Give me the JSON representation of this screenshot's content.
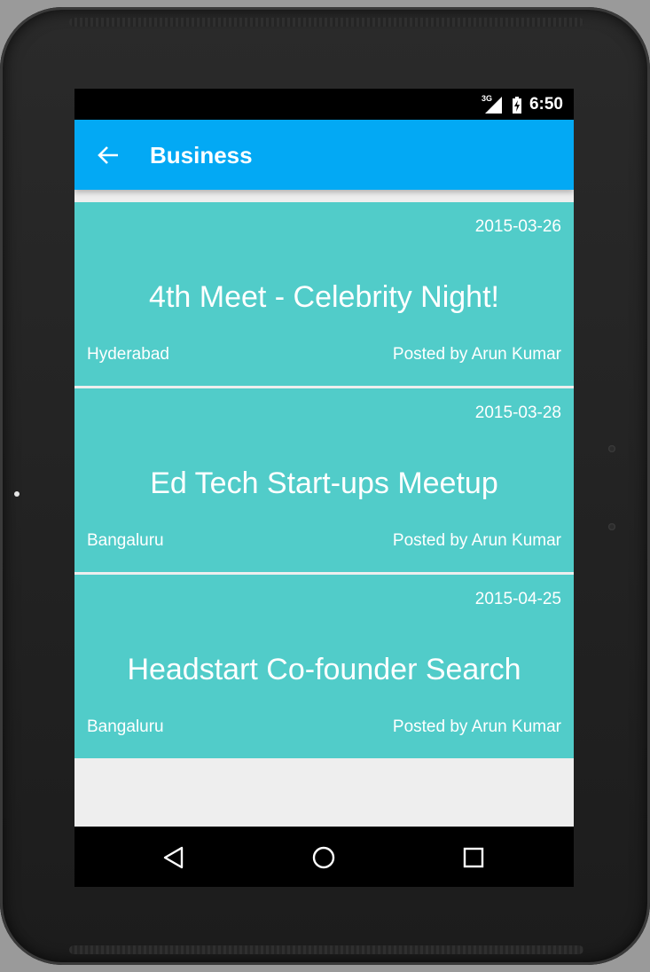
{
  "status_bar": {
    "network": "3G",
    "time": "6:50"
  },
  "app_bar": {
    "title": "Business",
    "back_icon": "arrow-left-icon",
    "background": "#03a9f4"
  },
  "events": [
    {
      "date": "2015-03-26",
      "title": "4th Meet - Celebrity Night!",
      "city": "Hyderabad",
      "author": "Posted by Arun Kumar"
    },
    {
      "date": "2015-03-28",
      "title": "Ed Tech Start-ups Meetup",
      "city": "Bangaluru",
      "author": "Posted by Arun Kumar"
    },
    {
      "date": "2015-04-25",
      "title": "Headstart Co-founder Search",
      "city": "Bangaluru",
      "author": "Posted by Arun Kumar"
    }
  ],
  "card_color": "#51ccc9",
  "nav_bar": {
    "back_icon": "triangle-back-icon",
    "home_icon": "circle-home-icon",
    "recents_icon": "square-recents-icon"
  }
}
